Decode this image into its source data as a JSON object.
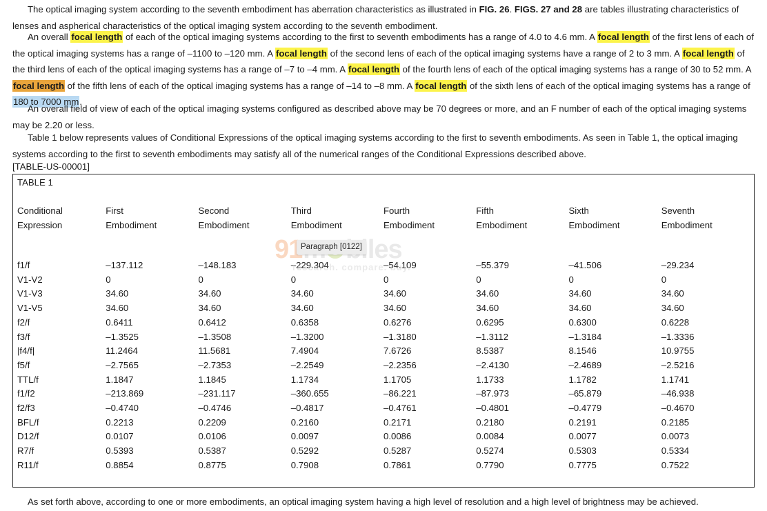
{
  "document": {
    "paragraph_1": {
      "before_bold_1": "The optical imaging system according to the seventh embodiment has aberration characteristics as illustrated in ",
      "bold_1": "FIG. 26",
      "between": ". ",
      "bold_2": "FIGS. 27 and 28",
      "after_bold_2": " are tables illustrating characteristics of lenses and aspherical characteristics of the optical imaging system according to the seventh embodiment."
    },
    "paragraph_2": {
      "s1": "An overall ",
      "h1": "focal length",
      "s2": " of each of the optical imaging systems according to the first to seventh embodiments has a range of 4.0 to 4.6 mm. A ",
      "h2": "focal length",
      "s3": " of the first lens of each of the optical imaging systems has a range of –1100 to –120 mm. A ",
      "h3": "focal length",
      "s4": " of the second lens of each of the optical imaging systems have a range of 2 to 3 mm. A ",
      "h4": "focal length",
      "s5": " of the third lens of each of the optical imaging systems has a range of –7 to –4 mm. A ",
      "h5": "focal length",
      "s6": " of the fourth lens of each of the optical imaging systems has a range of 30 to 52 mm. A ",
      "h6": "focal length",
      "s7": " of the fifth lens of each of the optical imaging systems has a range of –14 to –8 mm. A ",
      "h7": "focal length",
      "s8": " of the sixth lens of each of the optical imaging systems has a range of ",
      "h8": "180 to 7000 mm",
      "s9": "."
    },
    "paragraph_3": "An overall field of view of each of the optical imaging systems configured as described above may be 70 degrees or more, and an F number of each of the optical imaging systems may be 2.20 or less.",
    "paragraph_4": "Table 1 below represents values of Conditional Expressions of the optical imaging systems according to the first to seventh embodiments. As seen in Table 1, the optical imaging systems according to the first to seventh embodiments may satisfy all of the numerical ranges of the Conditional Expressions described above.",
    "table_label": "[TABLE-US-00001]",
    "closing_paragraph": "As set forth above, according to one or more embodiments, an optical imaging system having a high level of resolution and a high level of brightness may be achieved."
  },
  "highlight_colors": {
    "yellow": "#fcf34a",
    "orange": "#e9a53c",
    "blue": "#b9d9f2"
  },
  "table": {
    "title": "TABLE 1",
    "headers": [
      {
        "line1": "Conditional",
        "line2": "Expression"
      },
      {
        "line1": "First",
        "line2": "Embodiment"
      },
      {
        "line1": "Second",
        "line2": "Embodiment"
      },
      {
        "line1": "Third",
        "line2": "Embodiment"
      },
      {
        "line1": "Fourth",
        "line2": "Embodiment"
      },
      {
        "line1": "Fifth",
        "line2": "Embodiment"
      },
      {
        "line1": "Sixth",
        "line2": "Embodiment"
      },
      {
        "line1": "Seventh",
        "line2": "Embodiment"
      }
    ],
    "rows": [
      {
        "label": "f1/f",
        "values": [
          "–137.112",
          "–148.183",
          "–229.304",
          "–54.109",
          "–55.379",
          "–41.506",
          "–29.234"
        ]
      },
      {
        "label": "V1-V2",
        "values": [
          "0",
          "0",
          "0",
          "0",
          "0",
          "0",
          "0"
        ]
      },
      {
        "label": "V1-V3",
        "values": [
          "34.60",
          "34.60",
          "34.60",
          "34.60",
          "34.60",
          "34.60",
          "34.60"
        ]
      },
      {
        "label": "V1-V5",
        "values": [
          "34.60",
          "34.60",
          "34.60",
          "34.60",
          "34.60",
          "34.60",
          "34.60"
        ]
      },
      {
        "label": "f2/f",
        "values": [
          "0.6411",
          "0.6412",
          "0.6358",
          "0.6276",
          "0.6295",
          "0.6300",
          "0.6228"
        ]
      },
      {
        "label": "f3/f",
        "values": [
          "–1.3525",
          "–1.3508",
          "–1.3200",
          "–1.3180",
          "–1.3112",
          "–1.3184",
          "–1.3336"
        ]
      },
      {
        "label": "|f4/f|",
        "values": [
          "11.2464",
          "11.5681",
          "7.4904",
          "7.6726",
          "8.5387",
          "8.1546",
          "10.9755"
        ]
      },
      {
        "label": "f5/f",
        "values": [
          "–2.7565",
          "–2.7353",
          "–2.2549",
          "–2.2356",
          "–2.4130",
          "–2.4689",
          "–2.5216"
        ]
      },
      {
        "label": "TTL/f",
        "values": [
          "1.1847",
          "1.1845",
          "1.1734",
          "1.1705",
          "1.1733",
          "1.1782",
          "1.1741"
        ]
      },
      {
        "label": "f1/f2",
        "values": [
          "–213.869",
          "–231.117",
          "–360.655",
          "–86.221",
          "–87.973",
          "–65.879",
          "–46.938"
        ]
      },
      {
        "label": "f2/f3",
        "values": [
          "–0.4740",
          "–0.4746",
          "–0.4817",
          "–0.4761",
          "–0.4801",
          "–0.4779",
          "–0.4670"
        ]
      },
      {
        "label": "BFL/f",
        "values": [
          "0.2213",
          "0.2209",
          "0.2160",
          "0.2171",
          "0.2180",
          "0.2191",
          "0.2185"
        ]
      },
      {
        "label": "D12/f",
        "values": [
          "0.0107",
          "0.0106",
          "0.0097",
          "0.0086",
          "0.0084",
          "0.0077",
          "0.0073"
        ]
      },
      {
        "label": "R7/f",
        "values": [
          "0.5393",
          "0.5387",
          "0.5292",
          "0.5287",
          "0.5274",
          "0.5303",
          "0.5334"
        ]
      },
      {
        "label": "R11/f",
        "values": [
          "0.8854",
          "0.8775",
          "0.7908",
          "0.7861",
          "0.7790",
          "0.7775",
          "0.7522"
        ]
      }
    ]
  },
  "tooltip": {
    "text": "Paragraph [0122]"
  },
  "watermark": {
    "brand_prefix": "91",
    "brand_suffix_a": "m",
    "brand_suffix_b": "biles",
    "tagline": "research. compare. buy."
  }
}
